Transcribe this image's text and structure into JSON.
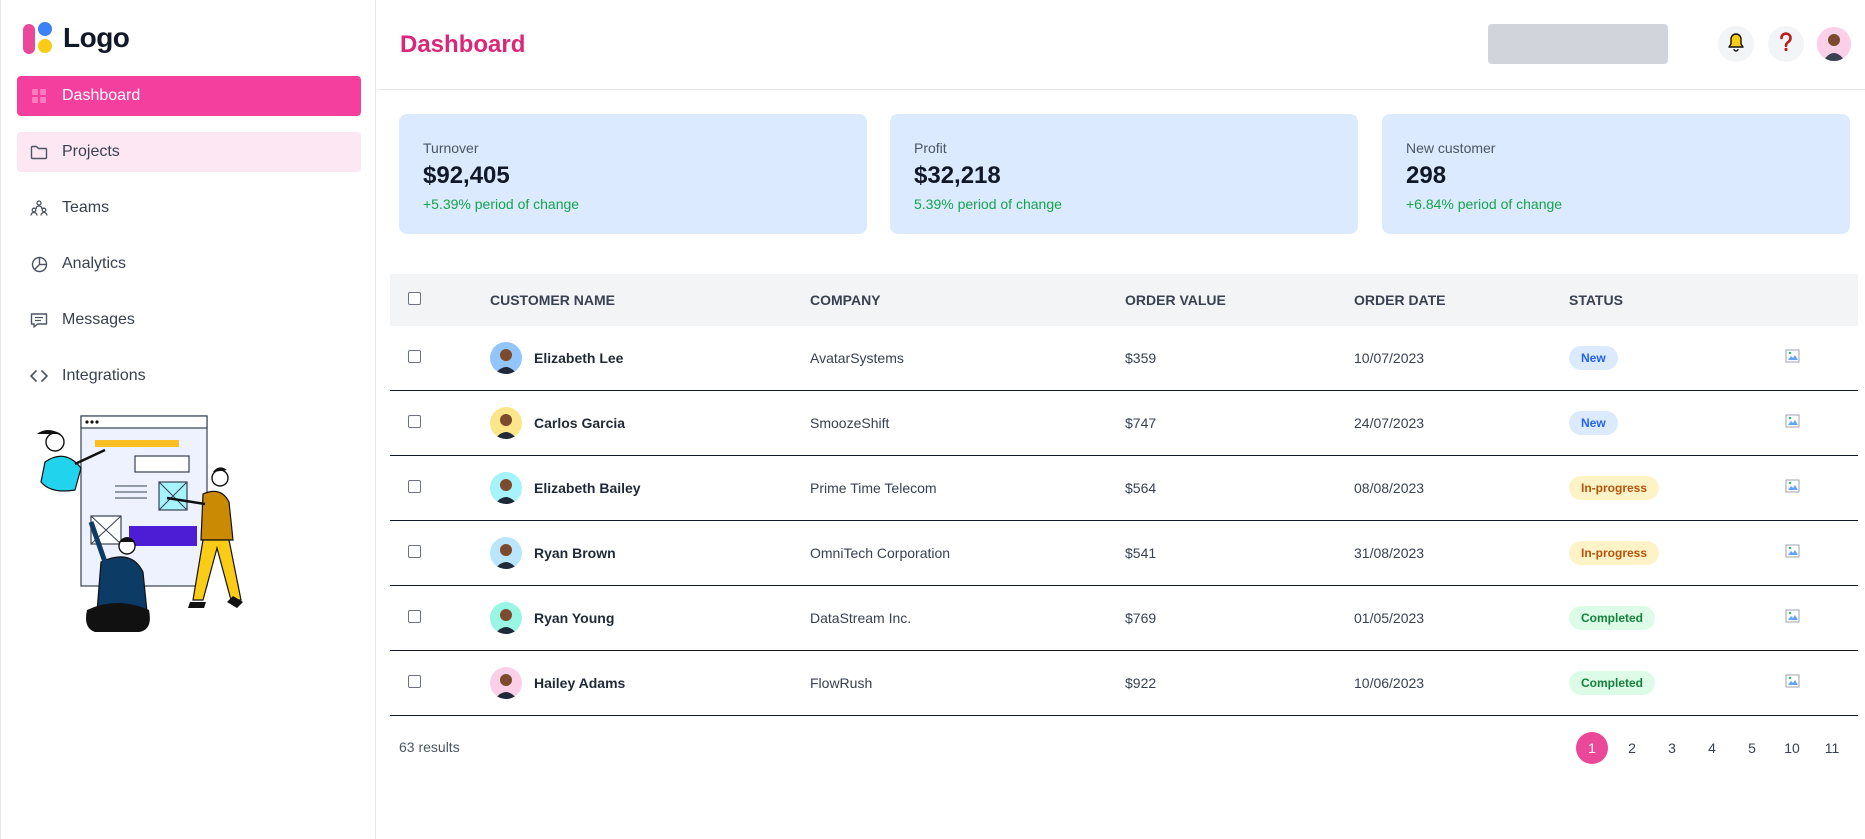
{
  "brand": {
    "logo_text": "Logo",
    "accent": "#ec4899"
  },
  "sidebar": {
    "items": [
      {
        "label": "Dashboard",
        "icon": "grid-icon",
        "state": "active"
      },
      {
        "label": "Projects",
        "icon": "folder-icon",
        "state": "hover"
      },
      {
        "label": "Teams",
        "icon": "teams-icon",
        "state": ""
      },
      {
        "label": "Analytics",
        "icon": "pie-chart-icon",
        "state": ""
      },
      {
        "label": "Messages",
        "icon": "message-icon",
        "state": ""
      },
      {
        "label": "Integrations",
        "icon": "code-icon",
        "state": ""
      }
    ]
  },
  "header": {
    "title": "Dashboard",
    "icons": [
      "bell-icon",
      "help-icon",
      "user-avatar"
    ]
  },
  "stats": [
    {
      "label": "Turnover",
      "value": "$92,405",
      "change": "+5.39% period of change"
    },
    {
      "label": "Profit",
      "value": "$32,218",
      "change": "5.39% period of change"
    },
    {
      "label": "New customer",
      "value": "298",
      "change": "+6.84% period of change"
    }
  ],
  "table": {
    "columns": [
      "CUSTOMER NAME",
      "COMPANY",
      "ORDER VALUE",
      "ORDER DATE",
      "STATUS"
    ],
    "rows": [
      {
        "name": "Elizabeth Lee",
        "company": "AvatarSystems",
        "value": "$359",
        "date": "10/07/2023",
        "status": "New",
        "status_kind": "new",
        "avatar_color": "#93c5fd"
      },
      {
        "name": "Carlos Garcia",
        "company": "SmoozeShift",
        "value": "$747",
        "date": "24/07/2023",
        "status": "New",
        "status_kind": "new",
        "avatar_color": "#fde68a"
      },
      {
        "name": "Elizabeth Bailey",
        "company": "Prime Time Telecom",
        "value": "$564",
        "date": "08/08/2023",
        "status": "In-progress",
        "status_kind": "prog",
        "avatar_color": "#a5f3fc"
      },
      {
        "name": "Ryan Brown",
        "company": "OmniTech Corporation",
        "value": "$541",
        "date": "31/08/2023",
        "status": "In-progress",
        "status_kind": "prog",
        "avatar_color": "#bae6fd"
      },
      {
        "name": "Ryan Young",
        "company": "DataStream Inc.",
        "value": "$769",
        "date": "01/05/2023",
        "status": "Completed",
        "status_kind": "done",
        "avatar_color": "#99f6e4"
      },
      {
        "name": "Hailey Adams",
        "company": "FlowRush",
        "value": "$922",
        "date": "10/06/2023",
        "status": "Completed",
        "status_kind": "done",
        "avatar_color": "#fbcfe8"
      }
    ]
  },
  "footer": {
    "results": "63 results",
    "pages": [
      "1",
      "2",
      "3",
      "4",
      "5",
      "10",
      "11"
    ],
    "current_page": "1"
  }
}
